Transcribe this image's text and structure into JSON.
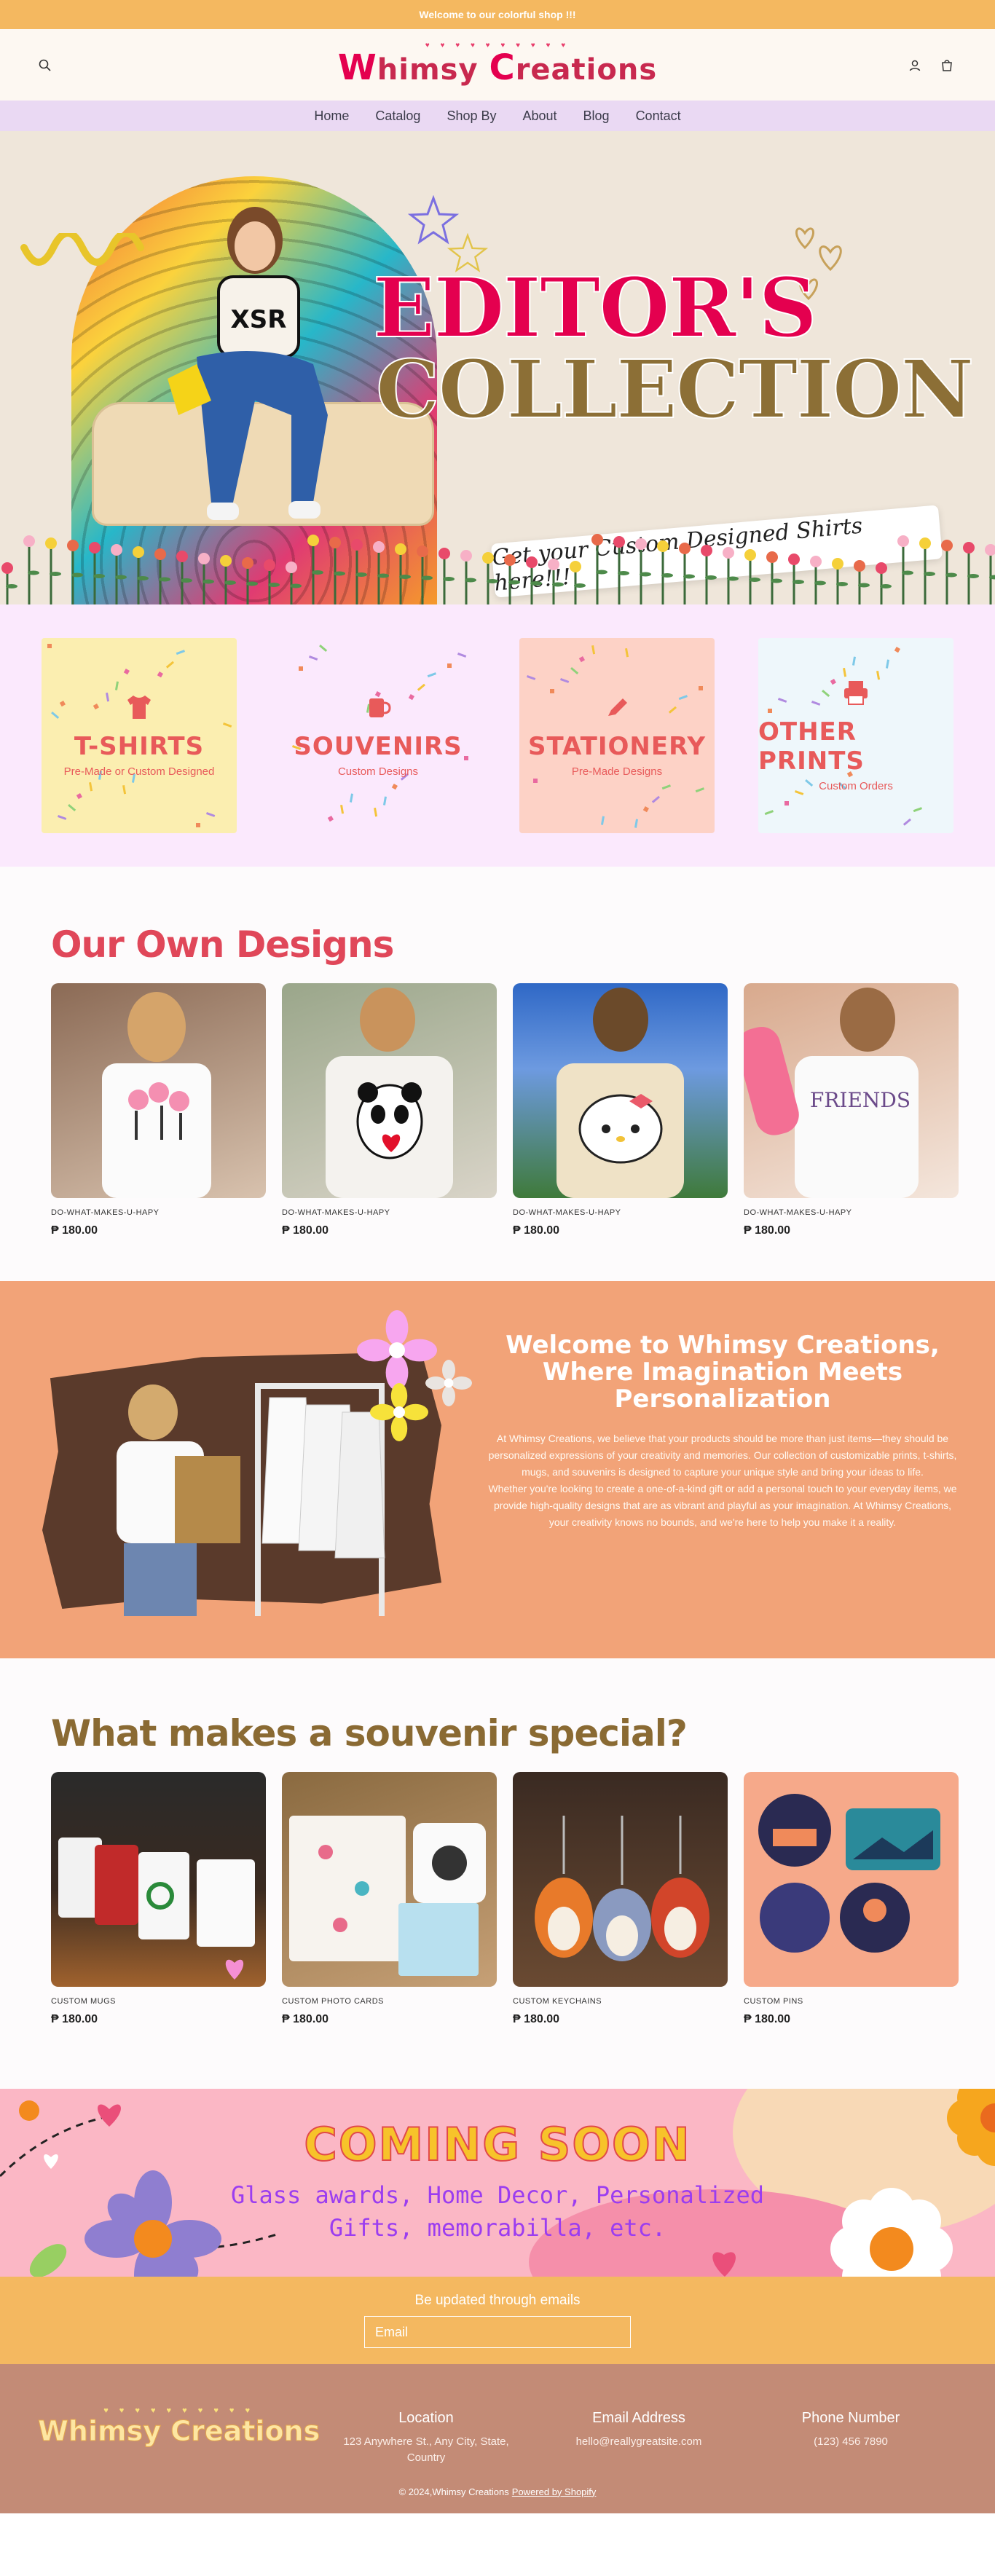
{
  "announcement": "Welcome to our colorful shop !!!",
  "header": {
    "logo_dots": "♥ ♥ ♥ ♥ ♥ ♥ ♥ ♥ ♥ ♥",
    "logo_w": "W",
    "logo_text1": "himsy ",
    "logo_c": "C",
    "logo_text2": "reations",
    "icons": [
      "search-icon",
      "account-icon",
      "cart-icon"
    ]
  },
  "nav": {
    "items": [
      "Home",
      "Catalog",
      "Shop By",
      "About",
      "Blog",
      "Contact"
    ]
  },
  "hero": {
    "title_line1": "EDITOR'S",
    "title_line2": "COLLECTION",
    "tagline": "Get your Custom Designed Shirts here!!!"
  },
  "categories": [
    {
      "name": "T-SHIRTS",
      "sub": "Pre-Made or Custom Designed",
      "bg": "#fbeeb0",
      "icon": "tshirt-icon"
    },
    {
      "name": "SOUVENIRS",
      "sub": "Custom Designs",
      "bg": "#fbe9fd",
      "icon": "mug-icon"
    },
    {
      "name": "STATIONERY",
      "sub": "Pre-Made Designs",
      "bg": "#fdd2c6",
      "icon": "pen-icon"
    },
    {
      "name": "OTHER PRINTS",
      "sub": "Custom Orders",
      "bg": "#eef7fb",
      "icon": "printer-icon"
    }
  ],
  "designs": {
    "heading": "Our Own Designs",
    "heading_color": "#e04759",
    "products": [
      {
        "name": "DO-WHAT-MAKES-U-HAPY",
        "price": "₱ 180.00"
      },
      {
        "name": "DO-WHAT-MAKES-U-HAPY",
        "price": "₱ 180.00"
      },
      {
        "name": "DO-WHAT-MAKES-U-HAPY",
        "price": "₱ 180.00"
      },
      {
        "name": "DO-WHAT-MAKES-U-HAPY",
        "price": "₱ 180.00"
      }
    ]
  },
  "welcome": {
    "heading": "Welcome to Whimsy Creations, Where Imagination Meets Personalization",
    "para1": "At Whimsy Creations, we believe that your products should be more than just items—they should be personalized expressions of your creativity and memories. Our collection of customizable prints, t-shirts, mugs, and souvenirs is designed to capture your unique style and bring your ideas to life.",
    "para2": "Whether you're looking to create a one-of-a-kind gift or add a personal touch to your everyday items, we provide high-quality designs that are as vibrant and playful as your imagination. At Whimsy Creations, your creativity knows no bounds, and we're here to help you make it a reality."
  },
  "souvenirs": {
    "heading": "What makes a souvenir special?",
    "heading_color": "#8a6a33",
    "products": [
      {
        "name": "CUSTOM MUGS",
        "price": "₱ 180.00"
      },
      {
        "name": "CUSTOM PHOTO CARDS",
        "price": "₱ 180.00"
      },
      {
        "name": "CUSTOM KEYCHAINS",
        "price": "₱ 180.00"
      },
      {
        "name": "CUSTOM PINS",
        "price": "₱ 180.00"
      }
    ]
  },
  "coming_soon": {
    "title": "COMING SOON",
    "line1": "Glass awards, Home Decor, Personalized",
    "line2": "Gifts, memorabilla, etc."
  },
  "newsletter": {
    "label": "Be updated through emails",
    "placeholder": "Email"
  },
  "footer": {
    "logo_w": "W",
    "logo_text1": "himsy ",
    "logo_c": "C",
    "logo_text2": "reations",
    "logo_dots": "♥ ♥ ♥ ♥ ♥ ♥ ♥ ♥ ♥ ♥",
    "location_h": "Location",
    "location_v": "123 Anywhere St., Any City, State, Country",
    "email_h": "Email Address",
    "email_v": "hello@reallygreatsite.com",
    "phone_h": "Phone Number",
    "phone_v": "(123) 456 7890",
    "copyright": "© 2024,Whimsy Creations",
    "powered": "Powered by Shopify"
  }
}
